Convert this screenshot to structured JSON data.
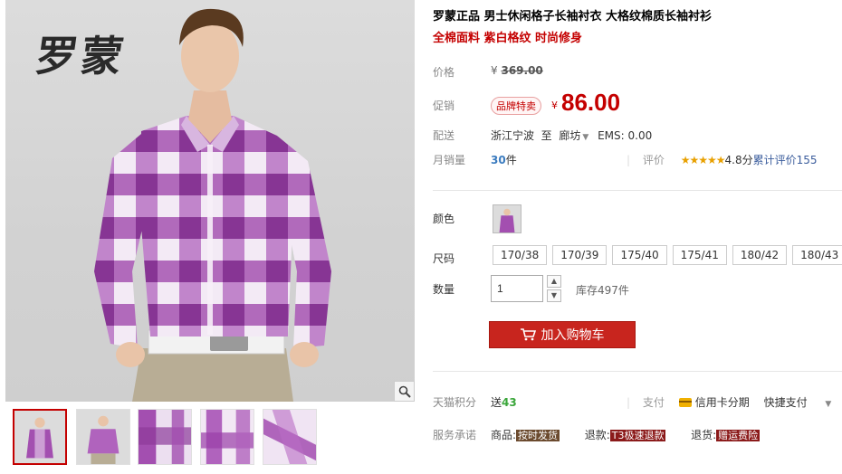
{
  "brand_logo": "罗蒙",
  "product": {
    "title": "罗蒙正品 男士休闲格子长袖衬衣 大格纹棉质长袖衬衫",
    "subtitle": "全棉面料 紫白格纹 时尚修身"
  },
  "price": {
    "label": "价格",
    "currency": "¥",
    "original": "369.00",
    "promo_label": "促销",
    "promo_tag": "品牌特卖",
    "sale": "86.00"
  },
  "shipping": {
    "label": "配送",
    "from": "浙江宁波",
    "to_word": "至",
    "to": "廊坊",
    "ems": "EMS: 0.00"
  },
  "sales": {
    "label": "月销量",
    "count": "30",
    "unit": "件",
    "rating_label": "评价",
    "stars": "★★★★★",
    "score": "4.8分",
    "review_link": "累计评价155"
  },
  "color": {
    "label": "颜色"
  },
  "size": {
    "label": "尺码",
    "options": [
      "170/38",
      "170/39",
      "175/40",
      "175/41",
      "180/42",
      "180/43"
    ]
  },
  "quantity": {
    "label": "数量",
    "value": "1",
    "stock": "库存497件"
  },
  "cart_button": "加入购物车",
  "tmall_points": {
    "label": "天猫积分",
    "prefix": "送",
    "value": "43"
  },
  "payment": {
    "label": "支付",
    "credit": "信用卡分期",
    "quick": "快捷支付"
  },
  "service": {
    "label": "服务承诺",
    "goods_label": "商品:",
    "goods_tag": "按时发货",
    "refund_label": "退款:",
    "refund_tag": "T3极速退款",
    "return_label": "退货:",
    "return_tag": "赠运费险"
  },
  "colors": {
    "accent_red": "#c40000",
    "button_red": "#c8251e",
    "shirt_purple": "#a34fb0",
    "link_blue": "#3a5c9c"
  }
}
